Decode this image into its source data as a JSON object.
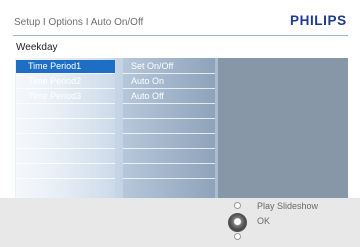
{
  "header": {
    "breadcrumb": "Setup I Options I Auto On/Off",
    "brand": "PHILIPS"
  },
  "page": {
    "title": "Weekday"
  },
  "menu_col1": {
    "items": [
      "Time Period1",
      "Time Period2",
      "Time Period3"
    ],
    "selected": "Time Period1"
  },
  "menu_col2": {
    "items": [
      "Set On/Off",
      "Auto On",
      "Auto Off"
    ]
  },
  "footer": {
    "play_label": "Play Slideshow",
    "ok_label": "OK"
  },
  "colors": {
    "brand": "#1f3a93",
    "selection": "#1f6ec6",
    "panel_dark": "#8897a8"
  }
}
